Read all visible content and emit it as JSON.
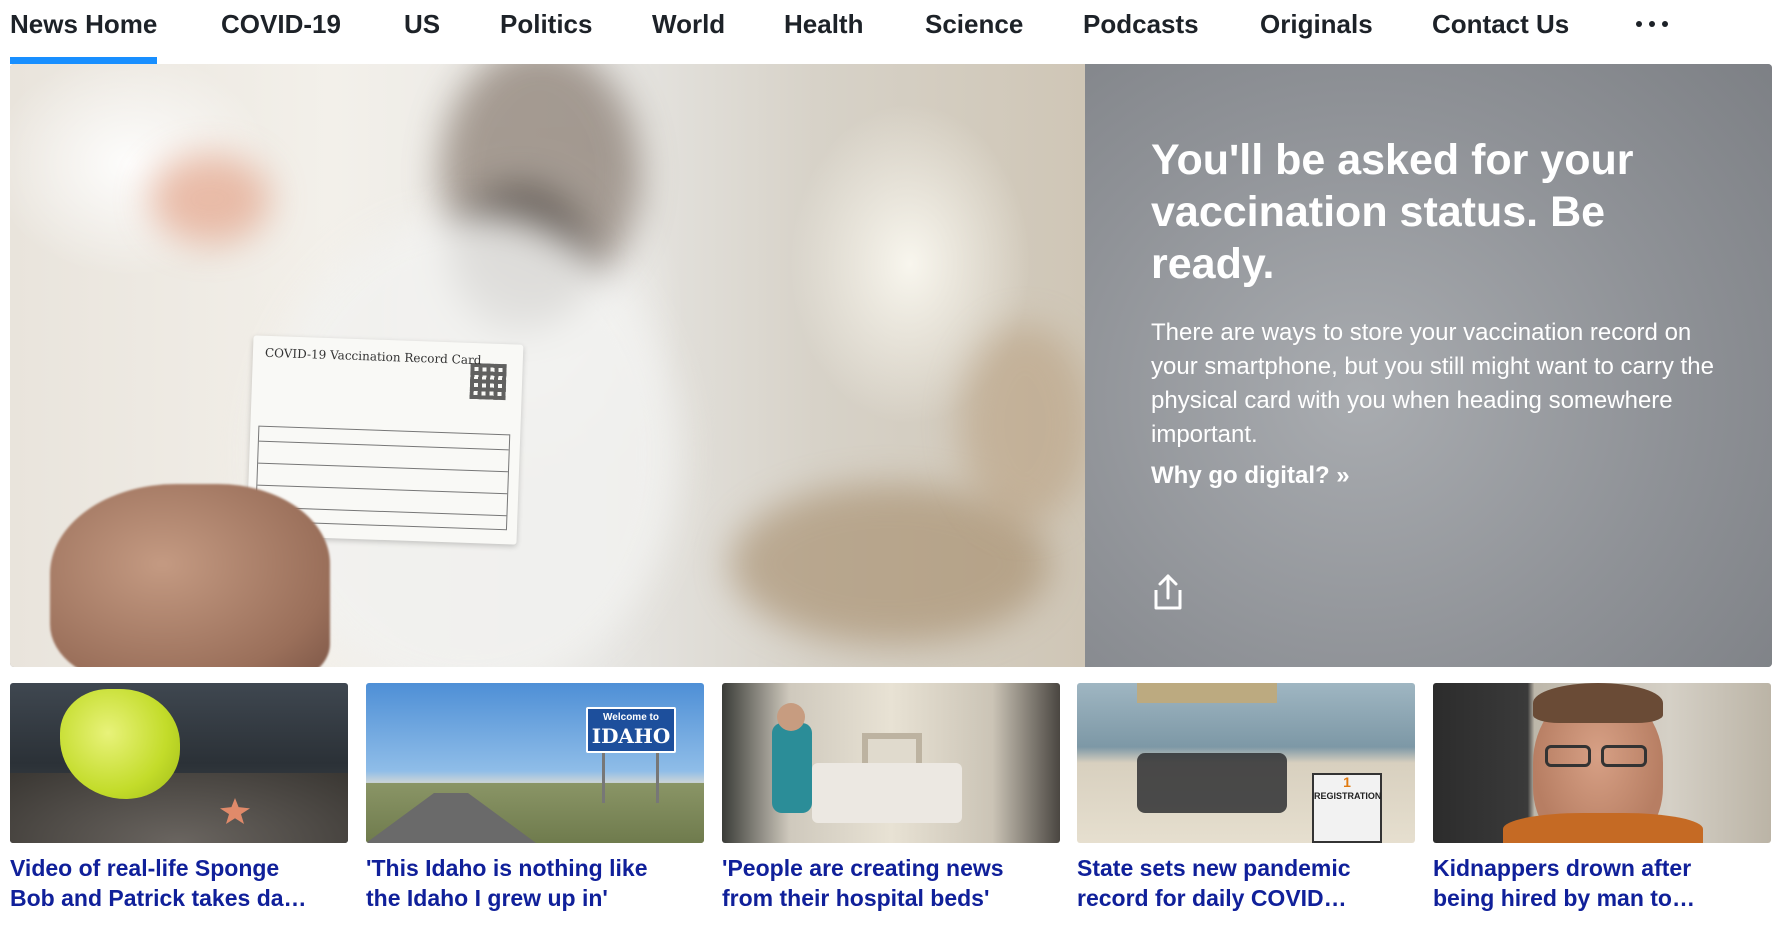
{
  "nav": {
    "items": [
      {
        "label": "News Home",
        "active": true
      },
      {
        "label": "COVID-19"
      },
      {
        "label": "US"
      },
      {
        "label": "Politics"
      },
      {
        "label": "World"
      },
      {
        "label": "Health"
      },
      {
        "label": "Science"
      },
      {
        "label": "Podcasts"
      },
      {
        "label": "Originals"
      },
      {
        "label": "Contact Us"
      }
    ],
    "more_icon": "more-horizontal-icon",
    "active_color": "#188fff"
  },
  "hero": {
    "image_card_text": "COVID-19 Vaccination Record Card",
    "title": "You'll be asked for your vaccination status. Be ready.",
    "summary": "There are ways to store your vaccination record on your smartphone, but you still might want to carry the physical card with you when heading somewhere important.",
    "link": "Why go digital? »",
    "share_icon": "share-icon"
  },
  "cards": [
    {
      "headline_line1": "Video of real-life Sponge",
      "headline_line2": "Bob and Patrick takes da…"
    },
    {
      "headline_line1": "'This Idaho is nothing like",
      "headline_line2": "the Idaho I grew up in'",
      "image_sign_line1": "Welcome to",
      "image_sign_line2": "IDAHO"
    },
    {
      "headline_line1": "'People are creating news",
      "headline_line2": "from their hospital beds'"
    },
    {
      "headline_line1": "State sets new pandemic",
      "headline_line2": "record for daily COVID…",
      "image_sign_line1": "1",
      "image_sign_line2": "REGISTRATION"
    },
    {
      "headline_line1": "Kidnappers drown after",
      "headline_line2": "being hired by man to…"
    }
  ],
  "colors": {
    "headline": "#10209a",
    "hero_panel": "#8f9297"
  }
}
